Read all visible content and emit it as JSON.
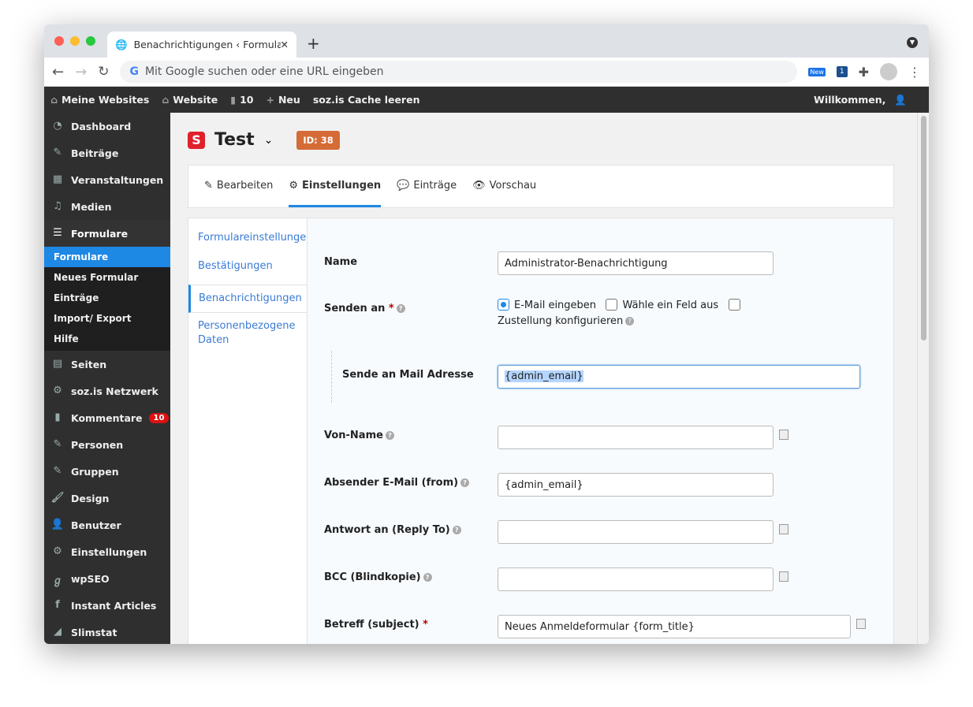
{
  "browser": {
    "tab_title": "Benachrichtigungen ‹ Formular",
    "omnibox_placeholder": "Mit Google suchen oder eine URL eingeben",
    "ext_new": "New",
    "ext_badge": "1"
  },
  "adminbar": {
    "items": [
      "Meine Websites",
      "Website",
      "10",
      "Neu",
      "soz.is Cache leeren"
    ],
    "welcome": "Willkommen,"
  },
  "sidebar": {
    "items": [
      {
        "label": "Dashboard",
        "icon": "dashboard-icon"
      },
      {
        "label": "Beiträge",
        "icon": "pin-icon"
      },
      {
        "label": "Veranstaltungen",
        "icon": "calendar-icon"
      },
      {
        "label": "Medien",
        "icon": "media-icon"
      },
      {
        "label": "Formulare",
        "icon": "forms-icon"
      }
    ],
    "submenu": [
      "Formulare",
      "Neues Formular",
      "Einträge",
      "Import/ Export",
      "Hilfe"
    ],
    "items2": [
      {
        "label": "Seiten"
      },
      {
        "label": "soz.is Netzwerk"
      },
      {
        "label": "Kommentare",
        "badge": "10"
      },
      {
        "label": "Personen"
      },
      {
        "label": "Gruppen"
      },
      {
        "label": "Design"
      },
      {
        "label": "Benutzer"
      },
      {
        "label": "Einstellungen"
      },
      {
        "label": "wpSEO"
      },
      {
        "label": "Instant Articles"
      },
      {
        "label": "Slimstat"
      }
    ]
  },
  "header": {
    "logo": "S",
    "title": "Test",
    "id_badge": "ID: 38"
  },
  "tabs": [
    "Bearbeiten",
    "Einstellungen",
    "Einträge",
    "Vorschau"
  ],
  "subnav": [
    "Formulareinstellungen",
    "Bestätigungen",
    "Benachrichtigungen",
    "Personenbezogene Daten"
  ],
  "form": {
    "name_label": "Name",
    "name_value": "Administrator-Benachrichtigung",
    "send_label": "Senden an",
    "send_options": [
      "E-Mail eingeben",
      "Wähle ein Feld aus",
      "Zustellung konfigurieren"
    ],
    "mail_label": "Sende an Mail Adresse",
    "mail_value": "{admin_email}",
    "fromname_label": "Von-Name",
    "fromname_value": "",
    "from_label": "Absender E-Mail (from)",
    "from_value": "{admin_email}",
    "reply_label": "Antwort an (Reply To)",
    "reply_value": "",
    "bcc_label": "BCC (Blindkopie)",
    "bcc_value": "",
    "subject_label": "Betreff (subject)",
    "subject_value": "Neues Anmeldeformular {form_title}"
  },
  "colors": {
    "accent": "#1e88e5",
    "id_badge": "#d56b36",
    "adminbar": "#2f2f2f"
  }
}
